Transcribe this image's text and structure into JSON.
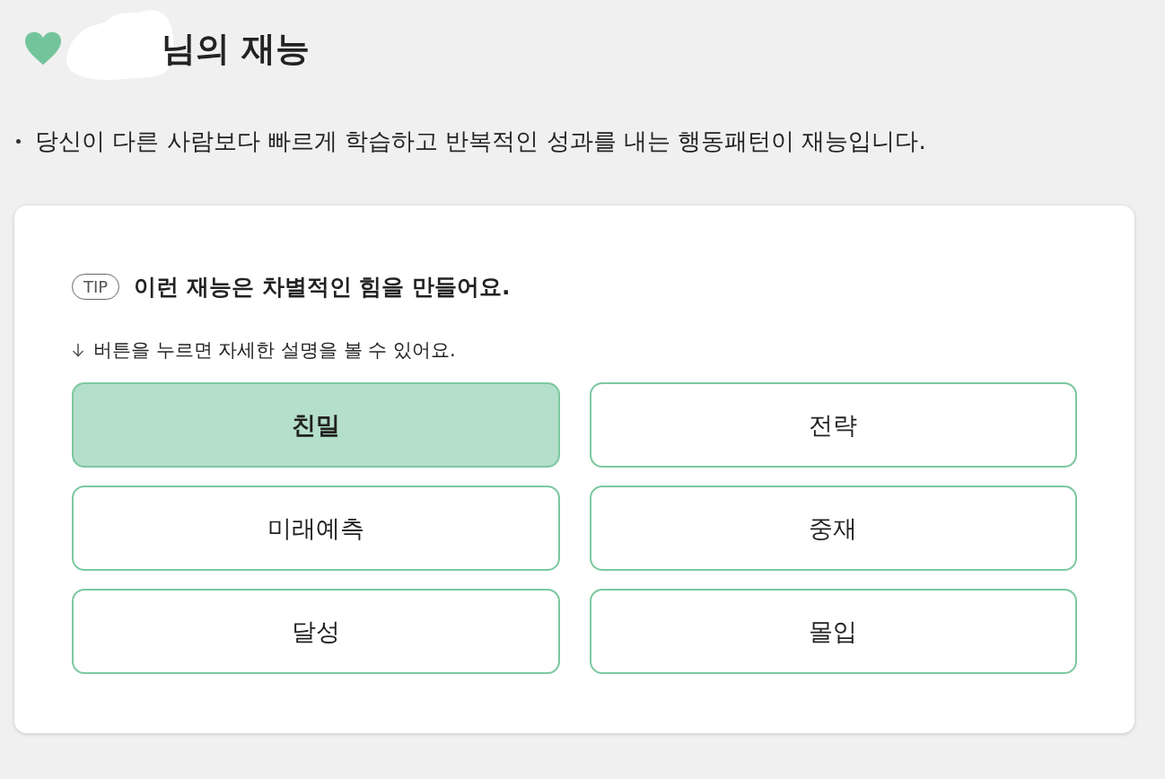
{
  "title": "님의 재능",
  "description": "당신이 다른 사람보다 빠르게 학습하고 반복적인 성과를 내는 행동패턴이 재능입니다.",
  "card": {
    "tip_badge": "TIP",
    "tip_text": "이런 재능은 차별적인 힘을 만들어요.",
    "hint": "버튼을 누르면 자세한 설명을 볼 수 있어요.",
    "talents": [
      {
        "label": "친밀",
        "selected": true
      },
      {
        "label": "전략",
        "selected": false
      },
      {
        "label": "미래예측",
        "selected": false
      },
      {
        "label": "중재",
        "selected": false
      },
      {
        "label": "달성",
        "selected": false
      },
      {
        "label": "몰입",
        "selected": false
      }
    ]
  }
}
